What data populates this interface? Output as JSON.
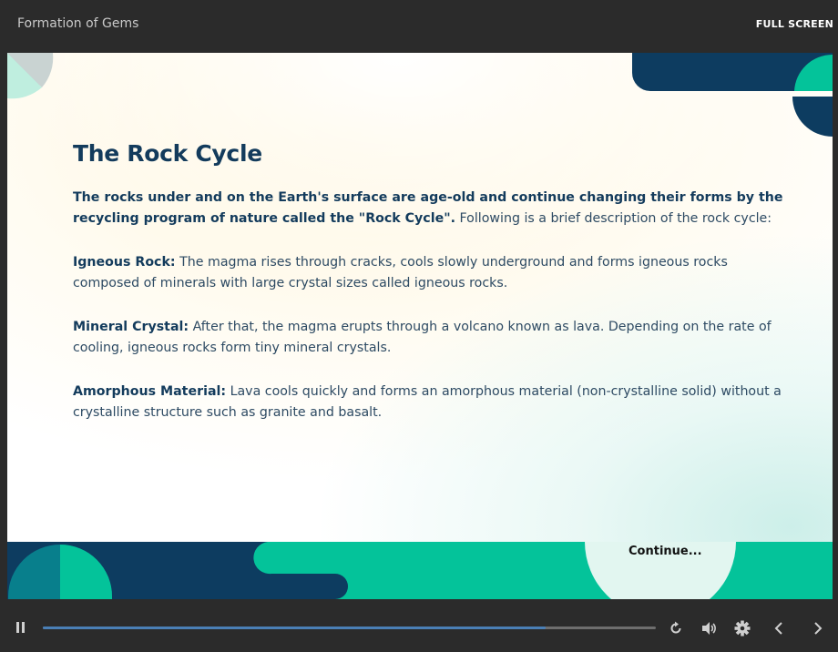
{
  "header": {
    "course_title": "Formation of Gems",
    "fullscreen_label": "FULL SCREEN"
  },
  "slide": {
    "title": "The Rock Cycle",
    "intro": {
      "bold": "The rocks under and on the Earth's surface are age-old and continue changing their forms by the recycling program of nature called the \"Rock Cycle\".",
      "text": " Following is a brief description of the rock cycle:"
    },
    "sections": [
      {
        "term": "Igneous Rock:",
        "text": " The magma rises through cracks, cools slowly underground and forms igneous rocks composed of minerals with large crystal sizes called igneous rocks."
      },
      {
        "term": "Mineral Crystal:",
        "text": " After that, the magma erupts through a volcano known as lava. Depending on the rate of cooling, igneous rocks form tiny mineral crystals."
      },
      {
        "term": "Amorphous Material:",
        "text": " Lava cools quickly and forms an amorphous material (non-crystalline solid) without a crystalline structure such as granite and basalt."
      }
    ],
    "continue_label": "Continue..."
  },
  "player": {
    "progress_fraction": 0.82,
    "icons": [
      "pause-icon",
      "replay-icon",
      "volume-icon",
      "settings-icon",
      "previous-icon",
      "next-icon"
    ]
  },
  "colors": {
    "navy": "#0d3c60",
    "teal": "#04c39a",
    "dark_teal": "#087f8c",
    "mint_light": "#bfeedf",
    "progress": "#4a7fb6"
  }
}
